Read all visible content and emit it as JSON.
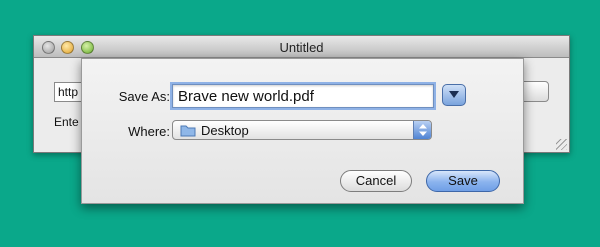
{
  "window": {
    "title": "Untitled",
    "url_field_value": "http",
    "enter_label": "Ente"
  },
  "sheet": {
    "save_as_label": "Save As:",
    "file_name": "Brave new world.pdf",
    "where_label": "Where:",
    "where_value": "Desktop",
    "cancel_label": "Cancel",
    "save_label": "Save"
  },
  "colors": {
    "background": "#0aa88a",
    "default_button": "#6f9fe6",
    "focus_ring": "#8fb2e6"
  },
  "icons": {
    "expand": "disclosure-triangle-icon",
    "folder": "folder-icon",
    "popup_arrows": "up-down-arrows-icon"
  }
}
